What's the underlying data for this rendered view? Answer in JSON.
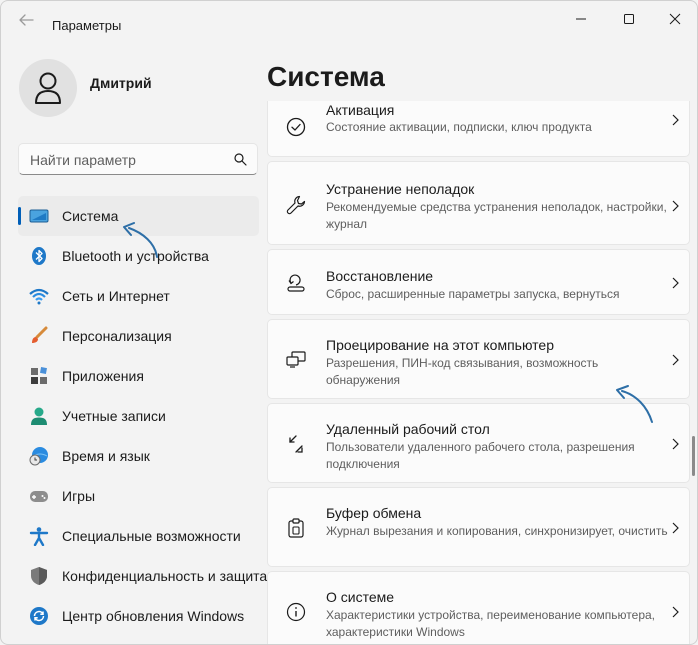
{
  "window": {
    "title": "Параметры"
  },
  "user": {
    "name": "Дмитрий"
  },
  "search": {
    "placeholder": "Найти параметр"
  },
  "sidebar": {
    "items": [
      {
        "label": "Система",
        "icon": "system-icon",
        "selected": true
      },
      {
        "label": "Bluetooth и устройства",
        "icon": "bluetooth-icon"
      },
      {
        "label": "Сеть и Интернет",
        "icon": "wifi-icon"
      },
      {
        "label": "Персонализация",
        "icon": "brush-icon"
      },
      {
        "label": "Приложения",
        "icon": "apps-icon"
      },
      {
        "label": "Учетные записи",
        "icon": "account-icon"
      },
      {
        "label": "Время и язык",
        "icon": "time-language-icon"
      },
      {
        "label": "Игры",
        "icon": "gamepad-icon"
      },
      {
        "label": "Специальные возможности",
        "icon": "accessibility-icon"
      },
      {
        "label": "Конфиденциальность и защита",
        "icon": "shield-icon"
      },
      {
        "label": "Центр обновления Windows",
        "icon": "update-icon"
      }
    ]
  },
  "main": {
    "title": "Система",
    "cards": [
      {
        "title": "Активация",
        "desc": "Состояние активации, подписки, ключ продукта",
        "icon": "check-circle-icon"
      },
      {
        "title": "Устранение неполадок",
        "desc": "Рекомендуемые средства устранения неполадок, настройки, журнал",
        "icon": "wrench-icon"
      },
      {
        "title": "Восстановление",
        "desc": "Сброс, расширенные параметры запуска, вернуться",
        "icon": "recovery-icon"
      },
      {
        "title": "Проецирование на этот компьютер",
        "desc": "Разрешения, ПИН-код связывания, возможность обнаружения",
        "icon": "projection-icon"
      },
      {
        "title": "Удаленный рабочий стол",
        "desc": "Пользователи удаленного рабочего стола, разрешения подключения",
        "icon": "remote-desktop-icon"
      },
      {
        "title": "Буфер обмена",
        "desc": "Журнал вырезания и копирования, синхронизирует, очистить",
        "icon": "clipboard-icon"
      },
      {
        "title": "О системе",
        "desc": "Характеристики устройства, переименование компьютера, характеристики Windows",
        "icon": "info-icon"
      }
    ]
  },
  "colors": {
    "accent": "#005fb8",
    "annotation_arrow": "#2e6fa7"
  }
}
